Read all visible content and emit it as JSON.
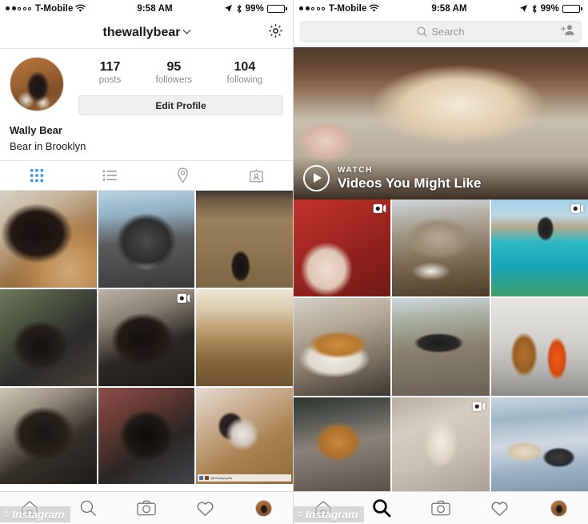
{
  "left_phone": {
    "status_bar": {
      "carrier": "T-Mobile",
      "signal_filled_dots": 2,
      "signal_empty_dots": 3,
      "wifi_icon": "wifi-icon",
      "time": "9:58 AM",
      "location_icon": "location-arrow-icon",
      "bluetooth_icon": "bluetooth-icon",
      "battery_percent": "99%",
      "battery_level": 99
    },
    "nav": {
      "title": "thewallybear",
      "dropdown_icon": "chevron-down-icon",
      "settings_icon": "gear-icon"
    },
    "profile": {
      "avatar_icon": "profile-avatar",
      "stats": [
        {
          "num": "117",
          "label": "posts"
        },
        {
          "num": "95",
          "label": "followers"
        },
        {
          "num": "104",
          "label": "following"
        }
      ],
      "edit_button": "Edit Profile",
      "full_name": "Wally Bear",
      "bio": "Bear in Brooklyn"
    },
    "view_tabs": [
      {
        "name": "grid-view",
        "icon": "grid-icon",
        "active": true
      },
      {
        "name": "list-view",
        "icon": "list-icon",
        "active": false
      },
      {
        "name": "map-view",
        "icon": "location-pin-icon",
        "active": false
      },
      {
        "name": "tagged-view",
        "icon": "tagged-person-icon",
        "active": false
      }
    ],
    "active_tab_color": "#3897f0",
    "grid": [
      {
        "name": "post-1",
        "badge": null,
        "caption": null
      },
      {
        "name": "post-2",
        "badge": null,
        "caption": null
      },
      {
        "name": "post-3",
        "badge": null,
        "caption": null
      },
      {
        "name": "post-4",
        "badge": null,
        "caption": null
      },
      {
        "name": "post-5",
        "badge": "video-icon",
        "caption": null
      },
      {
        "name": "post-6",
        "badge": null,
        "caption": null
      },
      {
        "name": "post-7",
        "badge": null,
        "caption": null
      },
      {
        "name": "post-8",
        "badge": null,
        "caption": null
      },
      {
        "name": "post-9",
        "badge": null,
        "caption": "@brooklynpets"
      }
    ],
    "tab_bar": [
      {
        "name": "home-tab",
        "icon": "home-icon",
        "active": false
      },
      {
        "name": "search-tab",
        "icon": "search-icon",
        "active": false
      },
      {
        "name": "camera-tab",
        "icon": "camera-icon",
        "active": false
      },
      {
        "name": "activity-tab",
        "icon": "heart-icon",
        "active": false
      },
      {
        "name": "profile-tab",
        "icon": "avatar-icon",
        "active": true
      }
    ],
    "watermark": {
      "symbol": "©",
      "text": "Instagram"
    }
  },
  "right_phone": {
    "status_bar": {
      "carrier": "T-Mobile",
      "signal_filled_dots": 2,
      "signal_empty_dots": 3,
      "wifi_icon": "wifi-icon",
      "time": "9:58 AM",
      "location_icon": "location-arrow-icon",
      "bluetooth_icon": "bluetooth-icon",
      "battery_percent": "99%",
      "battery_level": 99
    },
    "search": {
      "placeholder": "Search",
      "search_icon": "search-icon",
      "add_user_icon": "add-person-icon"
    },
    "watch_banner": {
      "kicker": "WATCH",
      "title": "Videos You Might Like",
      "play_icon": "play-circle-icon"
    },
    "grid": [
      {
        "name": "explore-1",
        "badge": "video-icon"
      },
      {
        "name": "explore-2",
        "badge": null
      },
      {
        "name": "explore-3",
        "badge": "video-icon"
      },
      {
        "name": "explore-4",
        "badge": null
      },
      {
        "name": "explore-5",
        "badge": null
      },
      {
        "name": "explore-6",
        "badge": null
      },
      {
        "name": "explore-7",
        "badge": null
      },
      {
        "name": "explore-8",
        "badge": "video-icon"
      },
      {
        "name": "explore-9",
        "badge": null
      }
    ],
    "tab_bar": [
      {
        "name": "home-tab",
        "icon": "home-icon",
        "active": false
      },
      {
        "name": "search-tab",
        "icon": "search-icon",
        "active": true
      },
      {
        "name": "camera-tab",
        "icon": "camera-icon",
        "active": false
      },
      {
        "name": "activity-tab",
        "icon": "heart-icon",
        "active": false
      },
      {
        "name": "profile-tab",
        "icon": "avatar-icon",
        "active": false
      }
    ],
    "watermark": {
      "symbol": "©",
      "text": "Instagram"
    }
  }
}
